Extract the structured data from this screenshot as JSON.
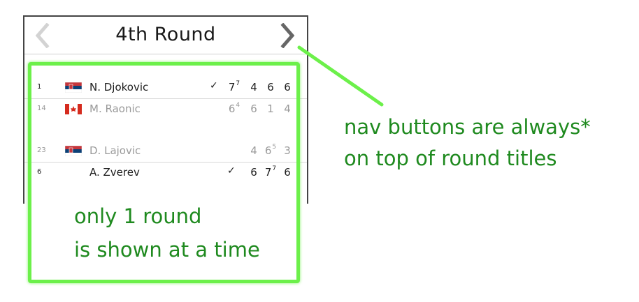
{
  "header": {
    "title": "4th Round",
    "prev_icon": "chevron-left-icon",
    "next_icon": "chevron-right-icon"
  },
  "matches": [
    {
      "players": [
        {
          "seed": "1",
          "flag": "serbia",
          "name": "N. Djokovic",
          "winner": true,
          "sets": [
            {
              "v": "7",
              "tb": "7"
            },
            {
              "v": "4",
              "tb": ""
            },
            {
              "v": "6",
              "tb": ""
            },
            {
              "v": "6",
              "tb": ""
            }
          ]
        },
        {
          "seed": "14",
          "flag": "canada",
          "name": "M. Raonic",
          "winner": false,
          "sets": [
            {
              "v": "6",
              "tb": "4"
            },
            {
              "v": "6",
              "tb": ""
            },
            {
              "v": "1",
              "tb": ""
            },
            {
              "v": "4",
              "tb": ""
            }
          ]
        }
      ]
    },
    {
      "players": [
        {
          "seed": "23",
          "flag": "serbia",
          "name": "D. Lajovic",
          "winner": false,
          "sets": [
            {
              "v": "4",
              "tb": ""
            },
            {
              "v": "6",
              "tb": "5"
            },
            {
              "v": "3",
              "tb": ""
            }
          ]
        },
        {
          "seed": "6",
          "flag": "",
          "name": "A. Zverev",
          "winner": true,
          "sets": [
            {
              "v": "6",
              "tb": ""
            },
            {
              "v": "7",
              "tb": "7"
            },
            {
              "v": "6",
              "tb": ""
            }
          ]
        }
      ]
    }
  ],
  "annotations": {
    "left_line1": "only 1 round",
    "left_line2": "is shown at a time",
    "right_line1": "nav buttons are always*",
    "right_line2": "on top of round titles"
  },
  "colors": {
    "annotation_green": "#1f8a1f",
    "highlight_green": "#6cf04a",
    "nav_disabled": "#d3d3d3",
    "nav_enabled": "#666666"
  }
}
